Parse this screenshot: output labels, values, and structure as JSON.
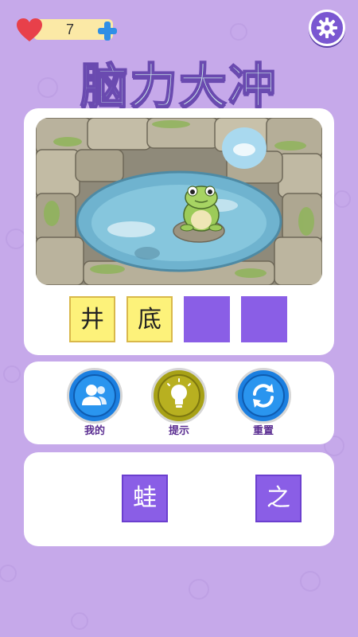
{
  "status": {
    "lives": "7"
  },
  "title": "脑力大冲",
  "answer_slots": [
    {
      "char": "井",
      "state": "filled"
    },
    {
      "char": "底",
      "state": "filled"
    },
    {
      "char": "",
      "state": "empty"
    },
    {
      "char": "",
      "state": "empty"
    }
  ],
  "tools": [
    {
      "label": "我的",
      "icon": "users-icon"
    },
    {
      "label": "提示",
      "icon": "lightbulb-icon"
    },
    {
      "label": "重置",
      "icon": "refresh-icon"
    }
  ],
  "letters": [
    "蛙",
    "之"
  ],
  "colors": {
    "background": "#c6a9ea",
    "slot_filled": "#fdf27a",
    "slot_empty": "#8a5ee6",
    "tile": "#8a5ee6",
    "title_fill": "#cfeeea",
    "title_stroke": "#6a4ab0"
  }
}
